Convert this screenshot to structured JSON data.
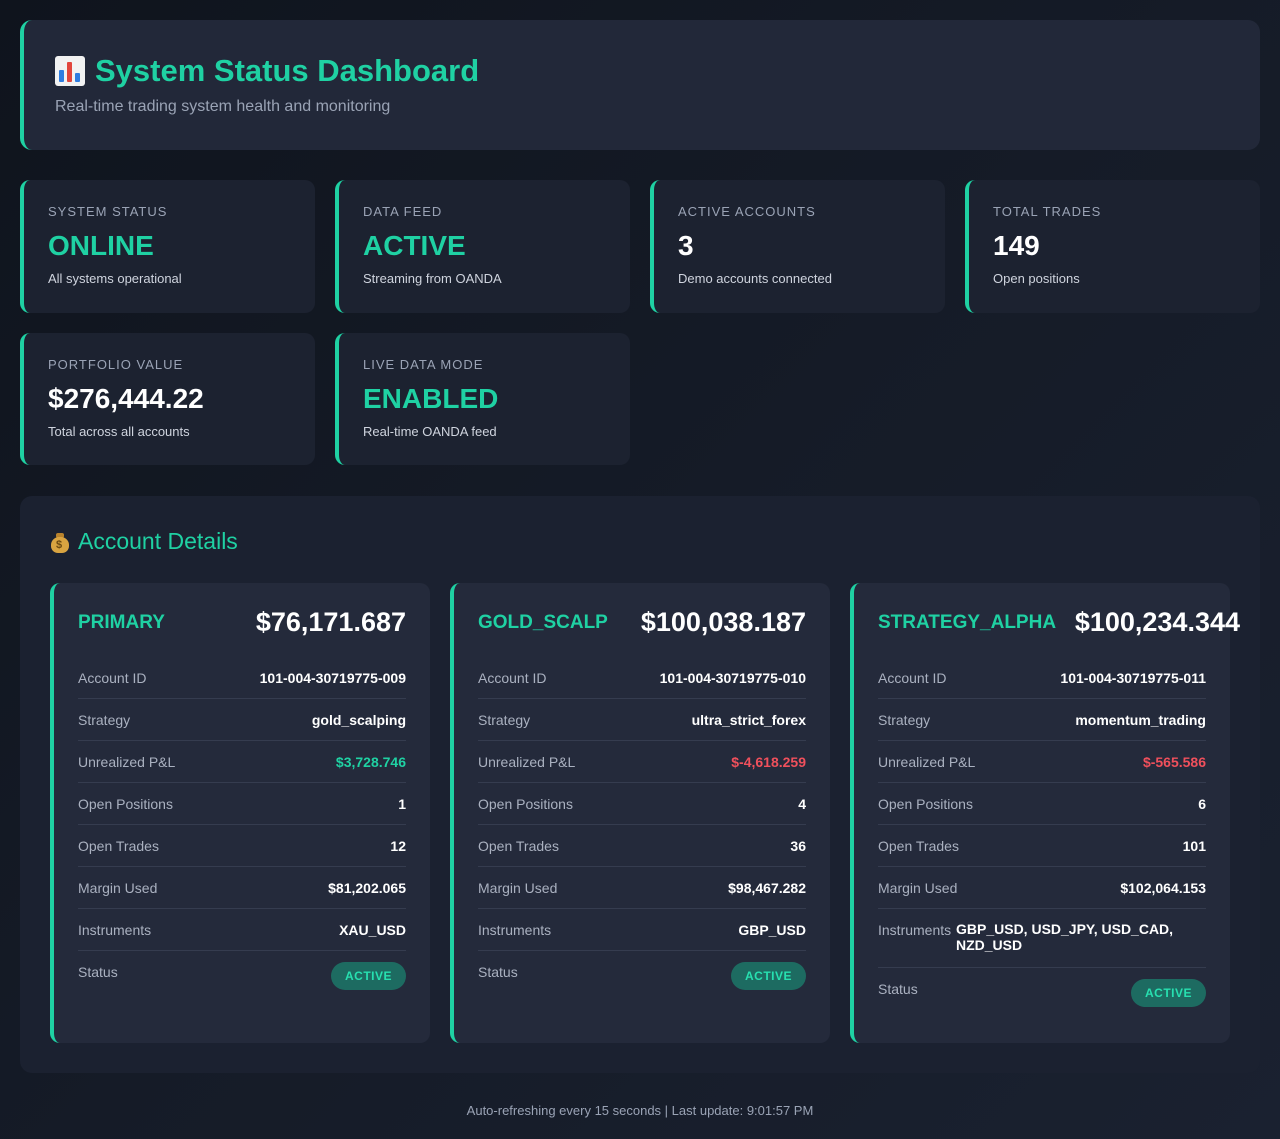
{
  "header": {
    "title": "System Status Dashboard",
    "subtitle": "Real-time trading system health and monitoring",
    "icon": "bar-chart-icon"
  },
  "stats": [
    {
      "label": "SYSTEM STATUS",
      "value": "ONLINE",
      "sub": "All systems operational"
    },
    {
      "label": "DATA FEED",
      "value": "ACTIVE",
      "sub": "Streaming from OANDA"
    },
    {
      "label": "ACTIVE ACCOUNTS",
      "value": "3",
      "sub": "Demo accounts connected"
    },
    {
      "label": "TOTAL TRADES",
      "value": "149",
      "sub": "Open positions"
    },
    {
      "label": "PORTFOLIO VALUE",
      "value": "$276,444.22",
      "sub": "Total across all accounts"
    },
    {
      "label": "LIVE DATA MODE",
      "value": "ENABLED",
      "sub": "Real-time OANDA feed"
    }
  ],
  "accounts_section": {
    "title": "Account Details",
    "icon": "money-bag-icon"
  },
  "row_labels": {
    "account_id": "Account ID",
    "strategy": "Strategy",
    "pnl": "Unrealized P&L",
    "positions": "Open Positions",
    "trades": "Open Trades",
    "margin": "Margin Used",
    "instruments": "Instruments",
    "status": "Status"
  },
  "accounts": [
    {
      "name": "PRIMARY",
      "balance": "$76,171.687",
      "account_id": "101-004-30719775-009",
      "strategy": "gold_scalping",
      "pnl": "$3,728.746",
      "positions": "1",
      "trades": "12",
      "margin": "$81,202.065",
      "instruments": "XAU_USD",
      "status": "ACTIVE"
    },
    {
      "name": "GOLD_SCALP",
      "balance": "$100,038.187",
      "account_id": "101-004-30719775-010",
      "strategy": "ultra_strict_forex",
      "pnl": "$-4,618.259",
      "positions": "4",
      "trades": "36",
      "margin": "$98,467.282",
      "instruments": "GBP_USD",
      "status": "ACTIVE"
    },
    {
      "name": "STRATEGY_ALPHA",
      "balance": "$100,234.344",
      "account_id": "101-004-30719775-011",
      "strategy": "momentum_trading",
      "pnl": "$-565.586",
      "positions": "6",
      "trades": "101",
      "margin": "$102,064.153",
      "instruments": "GBP_USD, USD_JPY, USD_CAD, NZD_USD",
      "status": "ACTIVE"
    }
  ],
  "footer": "Auto-refreshing every 15 seconds | Last update: 9:01:57 PM",
  "colors": {
    "accent": "#1fd1a3",
    "negative": "#f0505c",
    "background": "#151b27",
    "card": "#242a3b"
  }
}
